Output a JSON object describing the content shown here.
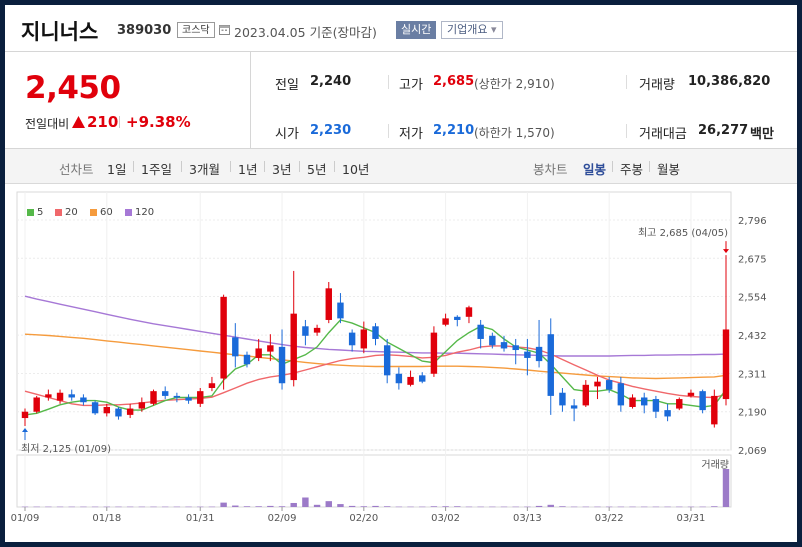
{
  "header": {
    "company": "지니너스",
    "code": "389030",
    "market": "코스닥",
    "date": "2023.04.05",
    "date_suffix": "기준(장마감)",
    "realtime_label": "실시간",
    "overview_label": "기업개요",
    "overview_arrow": "▾"
  },
  "quote": {
    "price": "2,450",
    "change_label": "전일대비",
    "change_value": "210",
    "change_pct": "+9.38%",
    "prev_label": "전일",
    "prev_value": "2,240",
    "high_label": "고가",
    "high_value": "2,685",
    "upper_limit": "(상한가 2,910)",
    "volume_label": "거래량",
    "volume_value": "10,386,820",
    "open_label": "시가",
    "open_value": "2,230",
    "low_label": "저가",
    "low_value": "2,210",
    "lower_limit": "(하한가 1,570)",
    "amount_label": "거래대금",
    "amount_value": "26,277",
    "amount_unit": "백만"
  },
  "colors": {
    "up": "#e0000b",
    "down": "#1a6ad9",
    "ma5": "#55b849",
    "ma20": "#f0686b",
    "ma60": "#f59b3d",
    "ma120": "#a678d6",
    "volume": "#9c7ac8"
  },
  "periods": {
    "line_label": "선차트",
    "line_items": [
      "1일",
      "1주일",
      "3개월",
      "1년",
      "3년",
      "5년",
      "10년"
    ],
    "candle_label": "봉차트",
    "candle_items": [
      "일봉",
      "주봉",
      "월봉"
    ],
    "active_candle": "일봉"
  },
  "chart_data": {
    "type": "candlestick",
    "legend": [
      "5",
      "20",
      "60",
      "120"
    ],
    "y_ticks": [
      "2,796",
      "2,675",
      "2,554",
      "2,432",
      "2,311",
      "2,190",
      "2,069"
    ],
    "y_tick_values": [
      2796,
      2675,
      2554,
      2432,
      2311,
      2190,
      2069
    ],
    "ylim": [
      2069,
      2796
    ],
    "x_ticks": [
      "01/09",
      "01/18",
      "01/31",
      "02/09",
      "02/20",
      "03/02",
      "03/13",
      "03/22",
      "03/31"
    ],
    "x_tick_index": [
      0,
      7,
      15,
      22,
      29,
      36,
      43,
      50,
      57
    ],
    "high_annotation": "최고 2,685 (04/05)",
    "low_annotation": "최저 2,125 (01/09)",
    "volume_label": "거래량",
    "candles": [
      [
        2170,
        2190,
        2145,
        2200
      ],
      [
        2190,
        2235,
        2185,
        2240
      ],
      [
        2235,
        2245,
        2225,
        2260
      ],
      [
        2225,
        2250,
        2215,
        2260
      ],
      [
        2245,
        2235,
        2225,
        2260
      ],
      [
        2235,
        2220,
        2210,
        2245
      ],
      [
        2220,
        2185,
        2180,
        2225
      ],
      [
        2185,
        2205,
        2175,
        2215
      ],
      [
        2200,
        2175,
        2165,
        2205
      ],
      [
        2180,
        2200,
        2170,
        2215
      ],
      [
        2200,
        2220,
        2190,
        2235
      ],
      [
        2215,
        2255,
        2210,
        2260
      ],
      [
        2255,
        2240,
        2230,
        2270
      ],
      [
        2240,
        2235,
        2220,
        2250
      ],
      [
        2235,
        2225,
        2215,
        2245
      ],
      [
        2215,
        2255,
        2205,
        2265
      ],
      [
        2265,
        2280,
        2255,
        2300
      ],
      [
        2295,
        2553,
        2260,
        2560
      ],
      [
        2425,
        2365,
        2330,
        2470
      ],
      [
        2370,
        2340,
        2330,
        2380
      ],
      [
        2360,
        2390,
        2350,
        2420
      ],
      [
        2380,
        2400,
        2350,
        2435
      ],
      [
        2395,
        2280,
        2260,
        2450
      ],
      [
        2290,
        2500,
        2270,
        2635
      ],
      [
        2460,
        2430,
        2400,
        2480
      ],
      [
        2440,
        2455,
        2430,
        2465
      ],
      [
        2480,
        2580,
        2470,
        2600
      ],
      [
        2535,
        2485,
        2470,
        2565
      ],
      [
        2440,
        2400,
        2380,
        2450
      ],
      [
        2390,
        2450,
        2375,
        2475
      ],
      [
        2460,
        2420,
        2400,
        2470
      ],
      [
        2400,
        2305,
        2280,
        2420
      ],
      [
        2310,
        2280,
        2260,
        2330
      ],
      [
        2275,
        2300,
        2270,
        2320
      ],
      [
        2305,
        2285,
        2280,
        2315
      ],
      [
        2310,
        2440,
        2300,
        2460
      ],
      [
        2465,
        2485,
        2460,
        2500
      ],
      [
        2490,
        2480,
        2460,
        2495
      ],
      [
        2490,
        2520,
        2470,
        2525
      ],
      [
        2465,
        2420,
        2390,
        2480
      ],
      [
        2430,
        2400,
        2390,
        2440
      ],
      [
        2410,
        2390,
        2380,
        2430
      ],
      [
        2400,
        2385,
        2340,
        2420
      ],
      [
        2380,
        2360,
        2305,
        2420
      ],
      [
        2395,
        2350,
        2330,
        2480
      ],
      [
        2435,
        2240,
        2180,
        2485
      ],
      [
        2250,
        2210,
        2190,
        2265
      ],
      [
        2210,
        2200,
        2160,
        2230
      ],
      [
        2210,
        2275,
        2205,
        2290
      ],
      [
        2270,
        2285,
        2230,
        2300
      ],
      [
        2290,
        2260,
        2250,
        2300
      ],
      [
        2280,
        2210,
        2190,
        2300
      ],
      [
        2205,
        2235,
        2200,
        2245
      ],
      [
        2235,
        2210,
        2185,
        2250
      ],
      [
        2230,
        2190,
        2170,
        2240
      ],
      [
        2195,
        2175,
        2160,
        2215
      ],
      [
        2200,
        2230,
        2195,
        2235
      ],
      [
        2240,
        2250,
        2235,
        2260
      ],
      [
        2255,
        2195,
        2185,
        2260
      ],
      [
        2150,
        2240,
        2140,
        2260
      ],
      [
        2230,
        2450,
        2210,
        2685
      ]
    ],
    "ma5": [
      2180,
      2185,
      2198,
      2212,
      2220,
      2225,
      2225,
      2220,
      2205,
      2195,
      2195,
      2210,
      2225,
      2235,
      2235,
      2235,
      2240,
      2290,
      2325,
      2340,
      2370,
      2370,
      2340,
      2355,
      2370,
      2395,
      2440,
      2480,
      2470,
      2455,
      2440,
      2410,
      2390,
      2370,
      2350,
      2345,
      2380,
      2415,
      2440,
      2460,
      2450,
      2420,
      2395,
      2385,
      2375,
      2340,
      2300,
      2260,
      2255,
      2255,
      2260,
      2245,
      2225,
      2225,
      2225,
      2215,
      2215,
      2210,
      2205,
      2210,
      2260
    ],
    "ma20": [
      2255,
      2245,
      2235,
      2225,
      2215,
      2210,
      2210,
      2212,
      2212,
      2214,
      2218,
      2222,
      2226,
      2228,
      2230,
      2232,
      2236,
      2250,
      2265,
      2280,
      2292,
      2300,
      2305,
      2312,
      2322,
      2332,
      2342,
      2352,
      2358,
      2362,
      2368,
      2370,
      2368,
      2365,
      2360,
      2362,
      2368,
      2378,
      2385,
      2395,
      2398,
      2398,
      2395,
      2392,
      2385,
      2372,
      2355,
      2338,
      2322,
      2305,
      2290,
      2280,
      2270,
      2262,
      2255,
      2248,
      2242,
      2238,
      2236,
      2235,
      2245
    ],
    "ma60": [
      2435,
      2433,
      2431,
      2428,
      2425,
      2422,
      2418,
      2414,
      2410,
      2406,
      2402,
      2398,
      2394,
      2390,
      2386,
      2382,
      2378,
      2374,
      2370,
      2366,
      2362,
      2358,
      2354,
      2350,
      2346,
      2342,
      2339,
      2337,
      2335,
      2334,
      2333,
      2333,
      2333,
      2333,
      2333,
      2334,
      2334,
      2334,
      2333,
      2332,
      2330,
      2328,
      2325,
      2322,
      2318,
      2315,
      2312,
      2309,
      2306,
      2303,
      2301,
      2299,
      2297,
      2296,
      2295,
      2296,
      2297,
      2298,
      2299,
      2300,
      2305
    ],
    "ma120": [
      2555,
      2546,
      2538,
      2530,
      2522,
      2514,
      2506,
      2498,
      2490,
      2482,
      2475,
      2468,
      2462,
      2456,
      2450,
      2444,
      2438,
      2432,
      2426,
      2420,
      2414,
      2408,
      2402,
      2397,
      2393,
      2390,
      2387,
      2385,
      2383,
      2381,
      2380,
      2379,
      2378,
      2377,
      2376,
      2376,
      2375,
      2375,
      2374,
      2373,
      2372,
      2371,
      2370,
      2369,
      2368,
      2367,
      2366,
      2366,
      2366,
      2366,
      2366,
      2367,
      2368,
      2368,
      2369,
      2369,
      2370,
      2370,
      2371,
      2371,
      2372
    ],
    "volume_values": [
      0.1,
      0.1,
      0.1,
      0.1,
      0.1,
      0.1,
      0.1,
      0.1,
      0.1,
      0.1,
      0.1,
      0.1,
      0.1,
      0.1,
      0.1,
      0.1,
      0.1,
      1.2,
      0.4,
      0.2,
      0.2,
      0.3,
      0.2,
      1.1,
      2.6,
      0.6,
      1.6,
      0.8,
      0.3,
      0.2,
      0.3,
      0.2,
      0.1,
      0.1,
      0.1,
      0.2,
      0.2,
      0.2,
      0.1,
      0.1,
      0.1,
      0.1,
      0.1,
      0.1,
      0.3,
      0.6,
      0.2,
      0.1,
      0.1,
      0.1,
      0.1,
      0.1,
      0.1,
      0.1,
      0.1,
      0.1,
      0.1,
      0.1,
      0.1,
      0.2,
      10.4
    ]
  }
}
